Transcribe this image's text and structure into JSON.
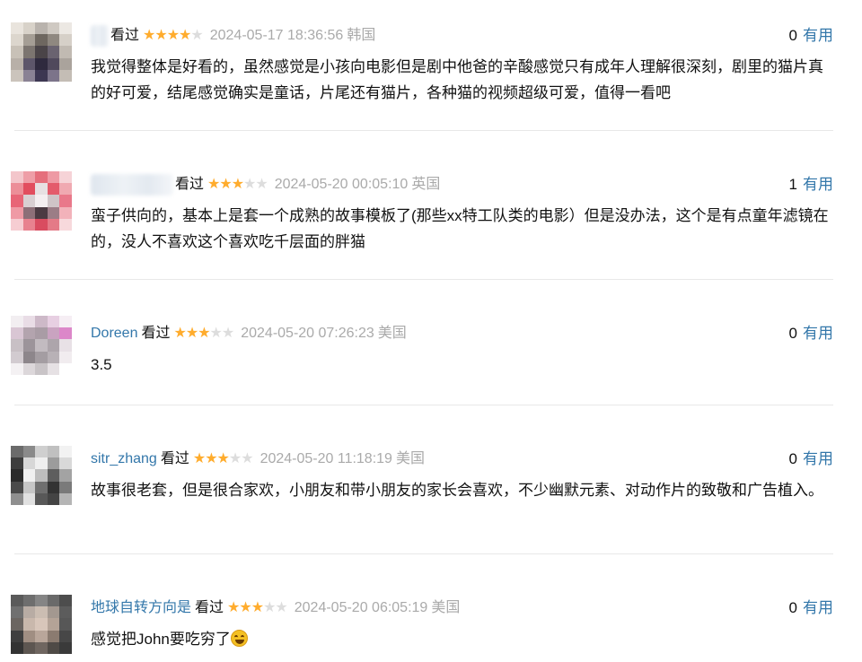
{
  "comments": [
    {
      "username": "",
      "watched": "看过",
      "stars": 4,
      "time": "2024-05-17 18:36:56",
      "location": "韩国",
      "vote_count": "0",
      "vote_label": "有用",
      "text": "我觉得整体是好看的，虽然感觉是小孩向电影但是剧中他爸的辛酸感觉只有成年人理解很深刻，剧里的猫片真的好可爱，结尾感觉确实是童话，片尾还有猫片，各种猫的视频超级可爱，值得一看吧"
    },
    {
      "username": "",
      "watched": "看过",
      "stars": 3,
      "time": "2024-05-20 00:05:10",
      "location": "英国",
      "vote_count": "1",
      "vote_label": "有用",
      "text": "蛮子供向的，基本上是套一个成熟的故事模板了(那些xx特工队类的电影）但是没办法，这个是有点童年滤镜在的，没人不喜欢这个喜欢吃千层面的胖猫"
    },
    {
      "username": "Doreen",
      "watched": "看过",
      "stars": 3,
      "time": "2024-05-20 07:26:23",
      "location": "美国",
      "vote_count": "0",
      "vote_label": "有用",
      "text": "3.5"
    },
    {
      "username": "sitr_zhang",
      "watched": "看过",
      "stars": 3,
      "time": "2024-05-20 11:18:19",
      "location": "美国",
      "vote_count": "0",
      "vote_label": "有用",
      "text": "故事很老套，但是很合家欢，小朋友和带小朋友的家长会喜欢，不少幽默元素、对动作片的致敬和广告植入。"
    },
    {
      "username": "地球自转方向是",
      "watched": "看过",
      "stars": 3,
      "time": "2024-05-20 06:05:19",
      "location": "美国",
      "vote_count": "0",
      "vote_label": "有用",
      "text": "感觉把John要吃穷了"
    }
  ],
  "colors": {
    "link": "#3377aa",
    "star": "#ffac2d",
    "muted": "#aaaaaa"
  },
  "icons": {
    "rating": "star-icon",
    "emoji": "laughing-tears-emoji-icon"
  }
}
